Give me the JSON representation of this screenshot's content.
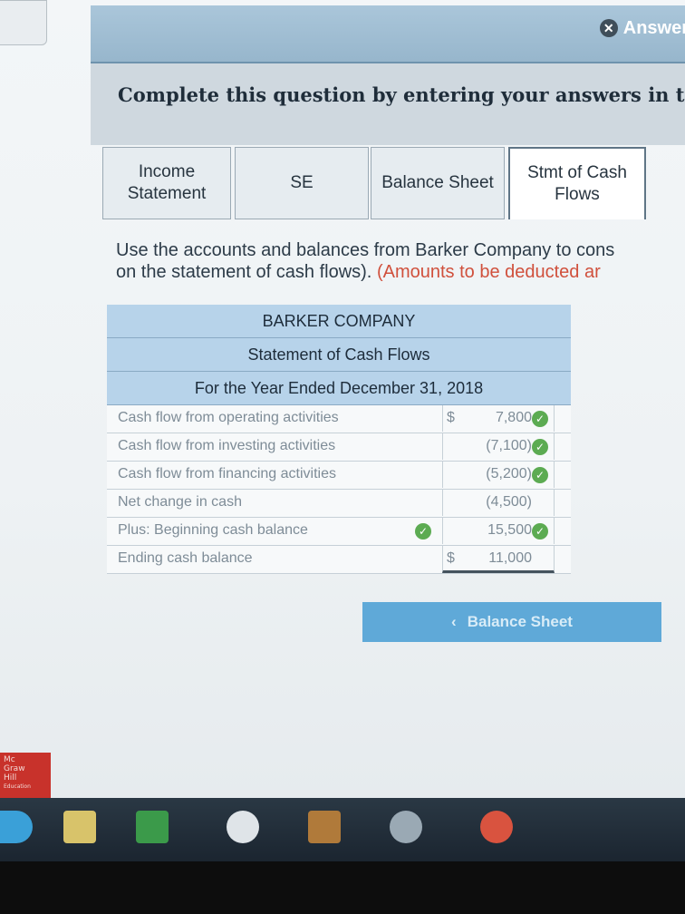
{
  "header": {
    "answer_label": "Answer"
  },
  "prompt": {
    "text": "Complete this question by entering your answers in t"
  },
  "tabs": [
    {
      "line1": "Income",
      "line2": "Statement"
    },
    {
      "line1": "SE",
      "line2": ""
    },
    {
      "line1": "Balance Sheet",
      "line2": ""
    },
    {
      "line1": "Stmt of Cash",
      "line2": "Flows"
    }
  ],
  "instructions": {
    "line1": "Use the accounts and balances from Barker Company to cons",
    "line2_main": "on the statement of cash flows).",
    "line2_red": "(Amounts to be deducted ar"
  },
  "statement": {
    "company": "BARKER COMPANY",
    "title": "Statement of Cash Flows",
    "period": "For the Year Ended December 31, 2018",
    "rows": [
      {
        "label": "Cash flow from operating activities",
        "symbol": "$",
        "amount": "7,800"
      },
      {
        "label": "Cash flow from investing activities",
        "symbol": "",
        "amount": "(7,100)"
      },
      {
        "label": "Cash flow from financing activities",
        "symbol": "",
        "amount": "(5,200)"
      },
      {
        "label": "Net change in cash",
        "symbol": "",
        "amount": "(4,500)"
      },
      {
        "label": "Plus: Beginning cash balance",
        "symbol": "",
        "amount": "15,500"
      },
      {
        "label": "Ending cash balance",
        "symbol": "$",
        "amount": "11,000"
      }
    ]
  },
  "nav": {
    "prev_label": "Balance Sheet"
  },
  "brand": {
    "line1": "Mc",
    "line2": "Graw",
    "line3": "Hill",
    "line4": "Education"
  },
  "colors": {
    "header_blue": "#b7d3ea",
    "check_green": "#5cab52",
    "nav_blue": "#5fa9d8",
    "note_red": "#d0503c"
  }
}
